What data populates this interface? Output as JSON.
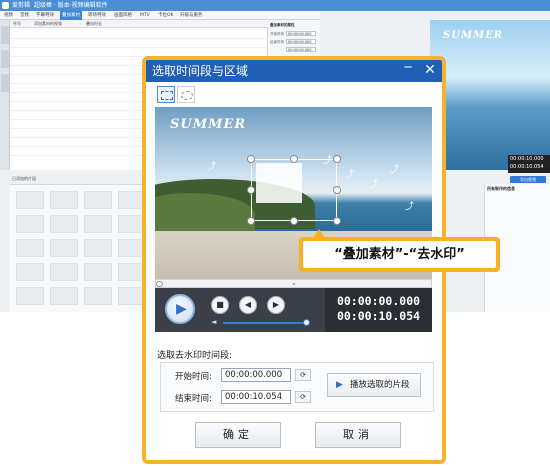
{
  "app": {
    "title": "爱剪辑",
    "subtitle": "超级棒 · 版本·视频编辑软件",
    "menu": [
      "视频",
      "音频",
      "字幕特效",
      "叠加素材",
      "转场特效",
      "画面风格",
      "MTV",
      "卡拉OK",
      "升级与服务"
    ],
    "active_menu_index": 3,
    "list_header": {
      "col1": "序号",
      "col2": "添加素材的视频",
      "col3": "叠加时长"
    },
    "props": {
      "title": "叠加素材的属性",
      "start_label": "开始时间",
      "end_label": "结束时间",
      "start_val": "00:00:00.000",
      "end_val": "00:00:00.000",
      "duration_val": "00:00:00.000"
    },
    "preview_text": "SUMMER",
    "preview_time": [
      "00:00:10.000",
      "00:00:10.054"
    ],
    "timeline_label": "已添加的片段",
    "export_label": "导出视频",
    "right_panel_title": "所有制作的信息"
  },
  "dialog": {
    "title": "选取时间段与区域",
    "min_icon": "minimize-icon",
    "close_icon": "close-icon",
    "canvas_text": "SUMMER",
    "timecode_current": "00:00:00.000",
    "timecode_total": "00:00:10.054",
    "range_title": "选取去水印时间段:",
    "start_label": "开始时间:",
    "end_label": "结束时间:",
    "start_value": "00:00:00.000",
    "end_value": "00:00:10.054",
    "play_segment_label": "播放选取的片段",
    "ok_label": "确定",
    "cancel_label": "取消",
    "volume_level": 0.78
  },
  "callout": {
    "text": "“叠加素材”-“去水印”"
  },
  "colors": {
    "accent_orange": "#f5b32c",
    "title_blue": "#1f5fb5",
    "menu_blue": "#3d86d8"
  }
}
